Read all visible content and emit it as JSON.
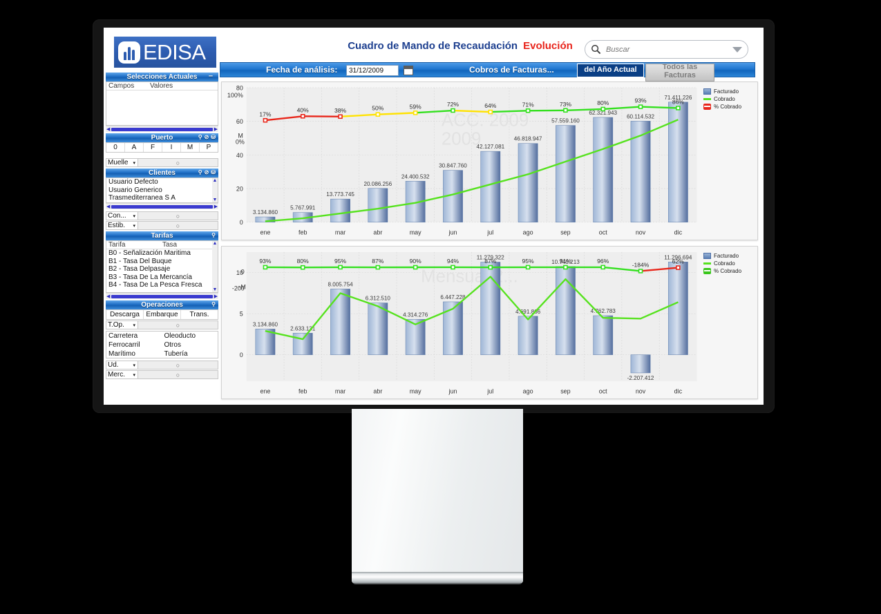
{
  "brand": {
    "name": "EDISA",
    "logo_icon": "edisa-logo-icon"
  },
  "header": {
    "title": "Cuadro de Mando de Recaudación",
    "subtitle": "Evolución"
  },
  "search": {
    "placeholder": "Buscar",
    "value": "",
    "icon": "search-icon",
    "caret_icon": "chevron-down-icon"
  },
  "toolbar": {
    "date_label": "Fecha de análisis:",
    "date_value": "31/12/2009",
    "calendar_icon": "calendar-icon",
    "cobros_label": "Cobros de Facturas...",
    "tab_active": "del Año Actual",
    "tab_inactive": "Todos las Facturas"
  },
  "sidebar": {
    "selecciones": {
      "title": "Selecciones Actuales",
      "minimize_icon": "minimize-icon",
      "columns": [
        "Campos",
        "Valores"
      ],
      "rows": []
    },
    "puerto": {
      "title": "Puerto",
      "icons": [
        "search-icon",
        "clear-icon",
        "lock-icon"
      ],
      "cells": [
        "0",
        "A",
        "F",
        "I",
        "M",
        "P"
      ],
      "combo": {
        "label": "Muelle",
        "value": ""
      }
    },
    "clientes": {
      "title": "Clientes",
      "icons": [
        "search-icon",
        "clear-icon",
        "lock-icon"
      ],
      "rows": [
        "Usuario Defecto",
        "Usuario Generico",
        "Trasmediterranea S A"
      ],
      "combos": [
        {
          "label": "Con...",
          "value": ""
        },
        {
          "label": "Estib.",
          "value": ""
        }
      ]
    },
    "tarifas": {
      "title": "Tarifas",
      "icons": [
        "search-icon"
      ],
      "columns": [
        "Tarifa",
        "Tasa"
      ],
      "rows": [
        "B0 - Señalización Maritima",
        "B1 - Tasa Del Buque",
        "B2 - Tasa Delpasaje",
        "B3 - Tasa De La Mercancía",
        "B4 - Tasa De La Pesca Fresca"
      ]
    },
    "operaciones": {
      "title": "Operaciones",
      "icons": [
        "search-icon"
      ],
      "columns": [
        "Descarga",
        "Embarque",
        "Trans."
      ],
      "combo_top": {
        "label": "T.Op.",
        "value": ""
      },
      "left_items": [
        "Carretera",
        "Ferrocarril",
        "Marítimo"
      ],
      "right_items": [
        "Oleoducto",
        "Otros",
        "Tubería"
      ],
      "combos": [
        {
          "label": "Ud.",
          "value": ""
        },
        {
          "label": "Merc.",
          "value": ""
        }
      ]
    }
  },
  "chart_data": [
    {
      "id": "acc-2009",
      "type": "bar",
      "title": "ACC. 2009",
      "watermark": "ACC. 2009",
      "xlabel": "",
      "ylabel": "M",
      "categories": [
        "ene",
        "feb",
        "mar",
        "abr",
        "may",
        "jun",
        "jul",
        "ago",
        "sep",
        "oct",
        "nov",
        "dic"
      ],
      "ylim": [
        0,
        80
      ],
      "yticks": [
        "0",
        "20",
        "40",
        "60",
        "80"
      ],
      "y2lim": [
        0,
        100
      ],
      "y2ticks": [
        "0%",
        "100%"
      ],
      "grid": true,
      "legend_position": "right",
      "series": [
        {
          "name": "Facturado",
          "kind": "bar",
          "color": "#6b8cc0",
          "values": [
            3134860,
            5767991,
            13773745,
            20086256,
            24400532,
            30847760,
            42127081,
            46818947,
            57559160,
            62321943,
            60114532,
            71411226
          ],
          "labels": [
            "3.134.860",
            "5.767.991",
            "13.773.745",
            "20.086.256",
            "24.400.532",
            "30.847.760",
            "42.127.081",
            "46.818.947",
            "57.559.160",
            "62.321.943",
            "60.114.532",
            "71.411.226"
          ]
        },
        {
          "name": "Cobrado",
          "kind": "line",
          "color": "#56e21e",
          "values": [
            0.5,
            2.3,
            5.2,
            8.0,
            11.5,
            16.5,
            22.5,
            28.5,
            36.0,
            43.5,
            51.5,
            61.0
          ]
        },
        {
          "name": "% Cobrado",
          "kind": "line-pct",
          "color": "#e8261a",
          "values": [
            17,
            40,
            38,
            50,
            59,
            72,
            64,
            71,
            73,
            80,
            93,
            86
          ],
          "labels": [
            "17%",
            "40%",
            "38%",
            "50%",
            "59%",
            "72%",
            "64%",
            "71%",
            "73%",
            "80%",
            "93%",
            "86%"
          ],
          "segment_colors": [
            "#e8261a",
            "#e8261a",
            "#e8261a",
            "#ffe200",
            "#ffe200",
            "#33e01e",
            "#ffe200",
            "#33e01e",
            "#33e01e",
            "#33e01e",
            "#33e01e",
            "#33e01e"
          ]
        }
      ]
    },
    {
      "id": "mensual-2009",
      "type": "bar",
      "title": "Mensual 2...",
      "watermark": "Mensual 2...",
      "xlabel": "",
      "ylabel": "M",
      "categories": [
        "ene",
        "feb",
        "mar",
        "abr",
        "may",
        "jun",
        "jul",
        "ago",
        "sep",
        "oct",
        "nov",
        "dic"
      ],
      "ylim": [
        -2.5,
        12
      ],
      "yticks": [
        "0",
        "5",
        "10"
      ],
      "y2lim": [
        -200,
        0
      ],
      "y2ticks": [
        "-200",
        "0"
      ],
      "grid": true,
      "legend_position": "right",
      "series": [
        {
          "name": "Facturado",
          "kind": "bar",
          "color": "#6b8cc0",
          "values": [
            3134860,
            2633131,
            8005754,
            6312510,
            4314276,
            6447228,
            11279322,
            4691866,
            10740213,
            4762783,
            -2207412,
            11296694
          ],
          "labels": [
            "3.134.860",
            "2.633.131",
            "8.005.754",
            "6.312.510",
            "4.314.276",
            "6.447.228",
            "11.279.322",
            "4.691.866",
            "10.740.213",
            "4.762.783",
            "-2.207.412",
            "11.296.694"
          ]
        },
        {
          "name": "Cobrado",
          "kind": "line",
          "color": "#56e21e",
          "values": [
            2.9,
            1.9,
            7.5,
            5.9,
            3.7,
            5.6,
            9.5,
            4.3,
            9.2,
            4.5,
            4.4,
            6.4
          ]
        },
        {
          "name": "% Cobrado",
          "kind": "line-pct",
          "color": "#38c61a",
          "values": [
            93,
            80,
            95,
            87,
            90,
            94,
            87,
            95,
            91,
            96,
            -184,
            62
          ],
          "labels": [
            "93%",
            "80%",
            "95%",
            "87%",
            "90%",
            "94%",
            "87%",
            "95%",
            "91%",
            "96%",
            "-184%",
            "62%"
          ],
          "segment_colors": [
            "#33e01e",
            "#33e01e",
            "#33e01e",
            "#33e01e",
            "#33e01e",
            "#33e01e",
            "#33e01e",
            "#33e01e",
            "#33e01e",
            "#33e01e",
            "#33e01e",
            "#e8261a"
          ]
        }
      ],
      "legend_entries": [
        "Facturado",
        "Cobrado",
        "% Cobrado"
      ]
    }
  ]
}
